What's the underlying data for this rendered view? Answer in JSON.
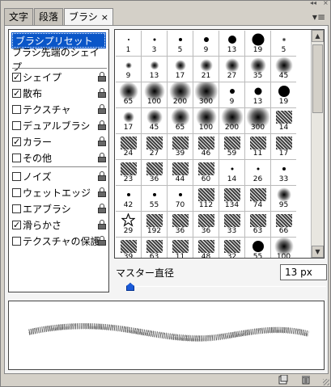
{
  "tabs": [
    {
      "label": "文字"
    },
    {
      "label": "段落"
    },
    {
      "label": "ブラシ",
      "close": "×"
    }
  ],
  "window_controls": {
    "collapse": "◂◂",
    "close": "×"
  },
  "panel_menu": "▾≡",
  "left_panel": {
    "preset_label": "ブラシプリセット",
    "tip_shape_label": "ブラシ先端のシェイプ",
    "options": [
      {
        "label": "シェイプ",
        "checked": true
      },
      {
        "label": "散布",
        "checked": true
      },
      {
        "label": "テクスチャ",
        "checked": false
      },
      {
        "label": "デュアルブラシ",
        "checked": false
      },
      {
        "label": "カラー",
        "checked": true
      },
      {
        "label": "その他",
        "checked": false
      }
    ],
    "options2": [
      {
        "label": "ノイズ",
        "checked": false
      },
      {
        "label": "ウェットエッジ",
        "checked": false
      },
      {
        "label": "エアブラシ",
        "checked": false
      },
      {
        "label": "滑らかさ",
        "checked": true
      },
      {
        "label": "テクスチャの保護",
        "checked": false
      }
    ]
  },
  "brushes": [
    {
      "n": "1",
      "k": "hard",
      "s": 2
    },
    {
      "n": "3",
      "k": "hard",
      "s": 3
    },
    {
      "n": "5",
      "k": "hard",
      "s": 4
    },
    {
      "n": "9",
      "k": "hard",
      "s": 6
    },
    {
      "n": "13",
      "k": "hard",
      "s": 10
    },
    {
      "n": "19",
      "k": "hard",
      "s": 15
    },
    {
      "n": "5",
      "k": "soft",
      "s": 5
    },
    {
      "n": "9",
      "k": "soft",
      "s": 8
    },
    {
      "n": "13",
      "k": "soft",
      "s": 11
    },
    {
      "n": "17",
      "k": "soft",
      "s": 14
    },
    {
      "n": "21",
      "k": "soft",
      "s": 16
    },
    {
      "n": "27",
      "k": "soft",
      "s": 18
    },
    {
      "n": "35",
      "k": "soft",
      "s": 20
    },
    {
      "n": "45",
      "k": "soft",
      "s": 22
    },
    {
      "n": "65",
      "k": "soft",
      "s": 24
    },
    {
      "n": "100",
      "k": "soft",
      "s": 26
    },
    {
      "n": "200",
      "k": "soft",
      "s": 28
    },
    {
      "n": "300",
      "k": "soft",
      "s": 30
    },
    {
      "n": "9",
      "k": "hard",
      "s": 6
    },
    {
      "n": "13",
      "k": "hard",
      "s": 9
    },
    {
      "n": "19",
      "k": "hard",
      "s": 14
    },
    {
      "n": "17",
      "k": "soft",
      "s": 14
    },
    {
      "n": "45",
      "k": "soft",
      "s": 20
    },
    {
      "n": "65",
      "k": "soft",
      "s": 24
    },
    {
      "n": "100",
      "k": "soft",
      "s": 26
    },
    {
      "n": "200",
      "k": "soft",
      "s": 28
    },
    {
      "n": "300",
      "k": "soft",
      "s": 30
    },
    {
      "n": "14",
      "k": "tex"
    },
    {
      "n": "24",
      "k": "tex"
    },
    {
      "n": "27",
      "k": "tex"
    },
    {
      "n": "39",
      "k": "tex"
    },
    {
      "n": "46",
      "k": "tex"
    },
    {
      "n": "59",
      "k": "tex"
    },
    {
      "n": "11",
      "k": "tex"
    },
    {
      "n": "17",
      "k": "tex"
    },
    {
      "n": "23",
      "k": "tex"
    },
    {
      "n": "36",
      "k": "tex"
    },
    {
      "n": "44",
      "k": "tex"
    },
    {
      "n": "60",
      "k": "tex"
    },
    {
      "n": "14",
      "k": "hard",
      "s": 3
    },
    {
      "n": "26",
      "k": "hard",
      "s": 3
    },
    {
      "n": "33",
      "k": "hard",
      "s": 4
    },
    {
      "n": "42",
      "k": "hard",
      "s": 4
    },
    {
      "n": "55",
      "k": "hard",
      "s": 4
    },
    {
      "n": "70",
      "k": "hard",
      "s": 4
    },
    {
      "n": "112",
      "k": "tex"
    },
    {
      "n": "134",
      "k": "tex"
    },
    {
      "n": "74",
      "k": "tex"
    },
    {
      "n": "95",
      "k": "soft",
      "s": 18
    },
    {
      "n": "29",
      "k": "star"
    },
    {
      "n": "192",
      "k": "tex"
    },
    {
      "n": "36",
      "k": "tex"
    },
    {
      "n": "36",
      "k": "tex"
    },
    {
      "n": "33",
      "k": "tex"
    },
    {
      "n": "63",
      "k": "tex"
    },
    {
      "n": "66",
      "k": "tex"
    },
    {
      "n": "39",
      "k": "tex"
    },
    {
      "n": "63",
      "k": "tex"
    },
    {
      "n": "11",
      "k": "tex"
    },
    {
      "n": "48",
      "k": "tex"
    },
    {
      "n": "32",
      "k": "tex"
    },
    {
      "n": "55",
      "k": "hard",
      "s": 14
    },
    {
      "n": "100",
      "k": "soft",
      "s": 24
    }
  ],
  "master_diameter": {
    "label": "マスター直径",
    "value": "13 px",
    "level_percent": 2
  },
  "scrollbar": {
    "up": "▲",
    "down": "▼"
  },
  "colors": {
    "selection": "#0a56c8",
    "slider": "#1a5ad8"
  }
}
